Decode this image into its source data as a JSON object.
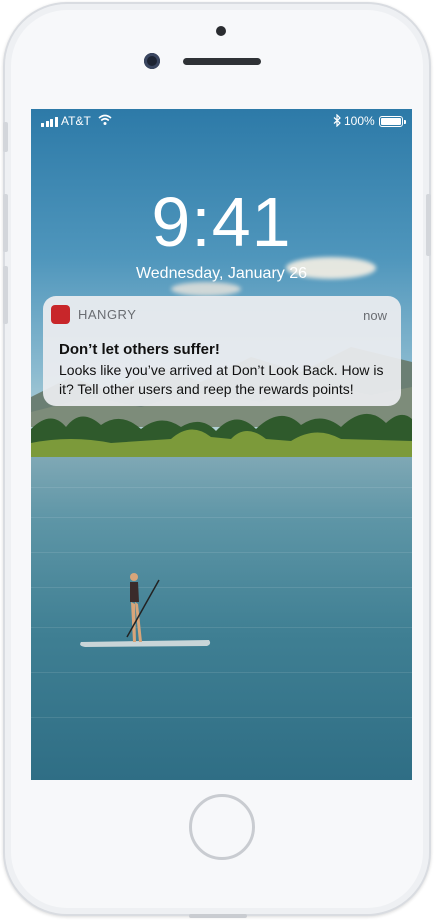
{
  "status_bar": {
    "carrier": "AT&T",
    "battery": "100%",
    "battery_level": 1.0,
    "icons": [
      "signal-bars-icon",
      "wifi-icon",
      "bluetooth-icon",
      "battery-icon"
    ]
  },
  "lock_screen": {
    "time": "9:41",
    "date": "Wednesday, January 26"
  },
  "notification": {
    "app_name": "HANGRY",
    "app_icon_color": "#c8262a",
    "timestamp": "now",
    "title": "Don’t let others suffer!",
    "body": "Looks like you’ve arrived at Don’t Look Back. How is it? Tell other users and reep the rewards points!"
  }
}
